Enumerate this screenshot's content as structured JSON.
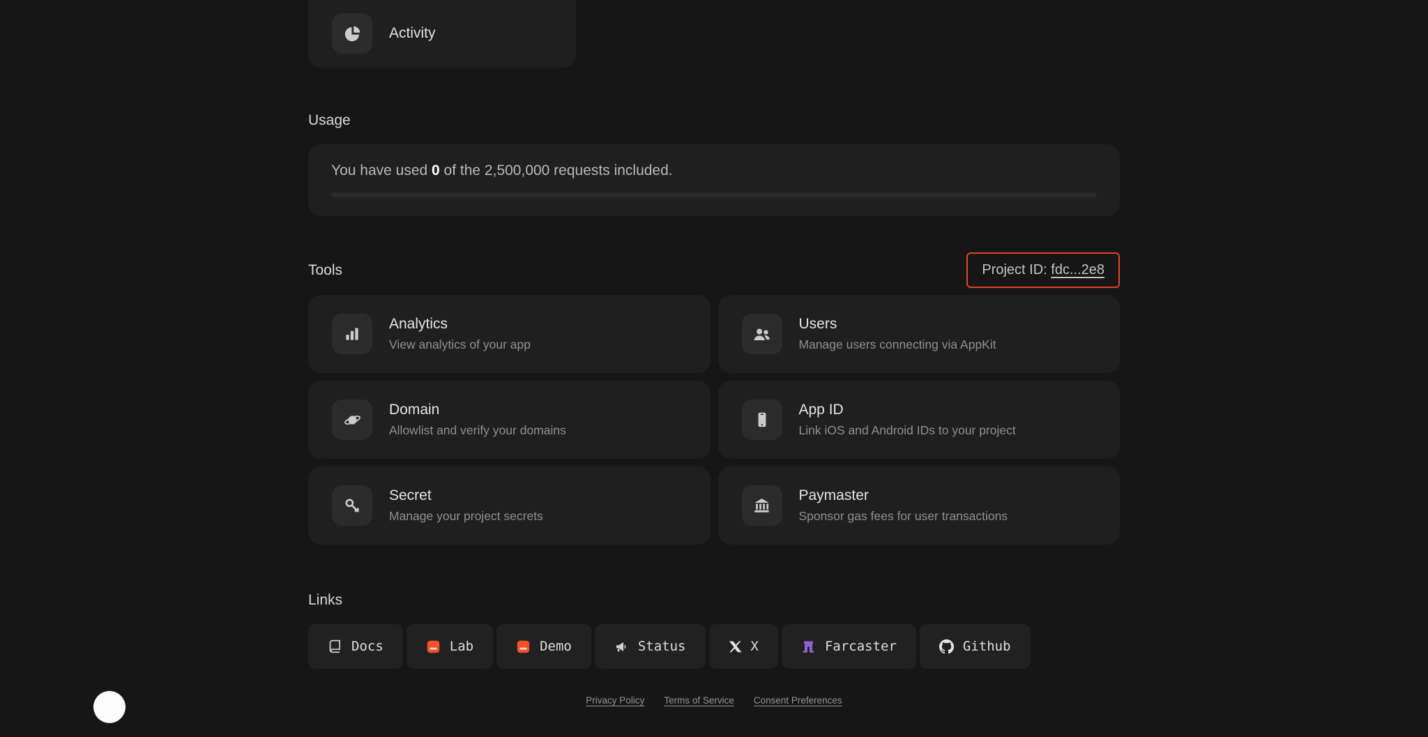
{
  "activity": {
    "label": "Activity",
    "icon": "pie-chart-icon"
  },
  "usage": {
    "heading": "Usage",
    "text_prefix": "You have used ",
    "used": "0",
    "text_suffix": " of the 2,500,000 requests included.",
    "progress_percent": 0
  },
  "tools": {
    "heading": "Tools",
    "project_id": {
      "label": "Project ID: ",
      "value": "fdc...2e8"
    },
    "cards": [
      {
        "title": "Analytics",
        "description": "View analytics of your app",
        "icon": "bar-chart-icon"
      },
      {
        "title": "Users",
        "description": "Manage users connecting via AppKit",
        "icon": "users-icon"
      },
      {
        "title": "Domain",
        "description": "Allowlist and verify your domains",
        "icon": "planet-icon"
      },
      {
        "title": "App ID",
        "description": "Link iOS and Android IDs to your project",
        "icon": "mobile-icon"
      },
      {
        "title": "Secret",
        "description": "Manage your project secrets",
        "icon": "key-icon"
      },
      {
        "title": "Paymaster",
        "description": "Sponsor gas fees for user transactions",
        "icon": "bank-icon"
      }
    ]
  },
  "links": {
    "heading": "Links",
    "items": [
      {
        "label": "Docs",
        "icon": "book-icon"
      },
      {
        "label": "Lab",
        "icon": "lab-icon"
      },
      {
        "label": "Demo",
        "icon": "demo-icon"
      },
      {
        "label": "Status",
        "icon": "megaphone-icon"
      },
      {
        "label": "X",
        "icon": "x-logo-icon"
      },
      {
        "label": "Farcaster",
        "icon": "farcaster-icon"
      },
      {
        "label": "Github",
        "icon": "github-icon"
      }
    ]
  },
  "footer": {
    "links": [
      "Privacy Policy",
      "Terms of Service",
      "Consent Preferences"
    ]
  },
  "colors": {
    "background": "#161616",
    "card": "#1f1f1f",
    "icon_tile": "#2b2b2b",
    "highlight_red": "#e5412d",
    "brand_orange": "#f0502a",
    "farcaster_purple": "#8a63d2"
  }
}
